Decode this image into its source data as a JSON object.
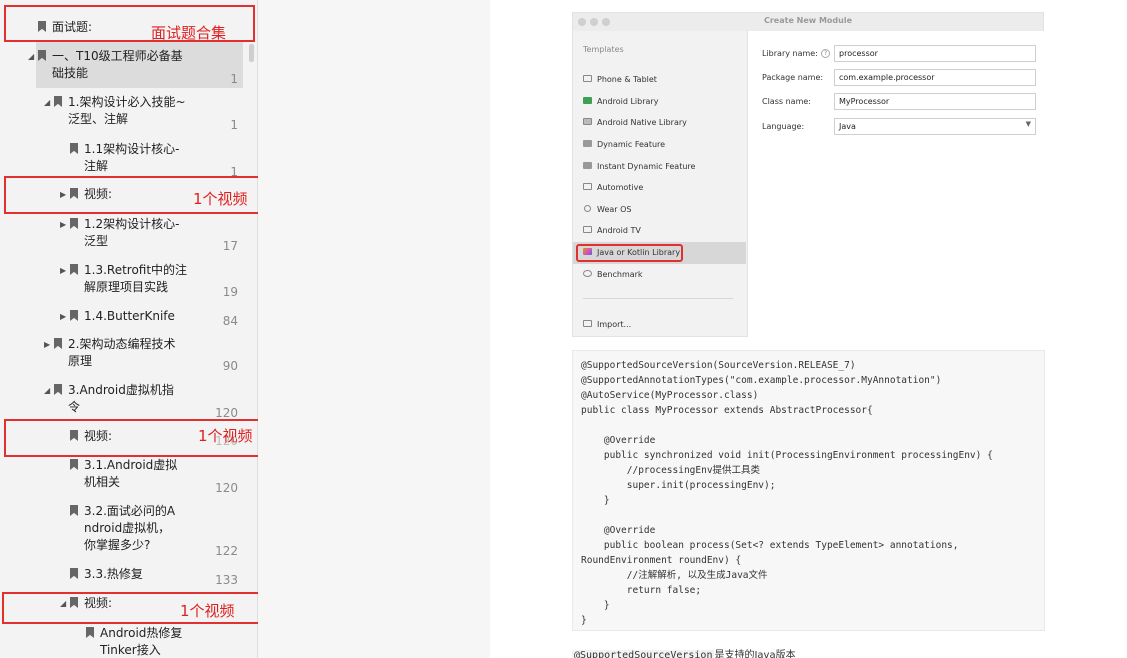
{
  "sidebar": {
    "items": [
      {
        "label": "面试题:",
        "page": ""
      },
      {
        "label": "一、T10级工程师必备基础技能",
        "page": "1"
      },
      {
        "label": "1.架构设计必入技能~泛型、注解",
        "page": "1"
      },
      {
        "label": "1.1架构设计核心-注解",
        "page": "1"
      },
      {
        "label": "视频:",
        "page": ""
      },
      {
        "label": "1.2架构设计核心-泛型",
        "page": "17"
      },
      {
        "label": "1.3.Retrofit中的注解原理项目实践",
        "page": "19"
      },
      {
        "label": "1.4.ButterKnife",
        "page": "84"
      },
      {
        "label": "2.架构动态编程技术原理",
        "page": "90"
      },
      {
        "label": "3.Android虚拟机指令",
        "page": "120"
      },
      {
        "label": "视频:",
        "page": "120"
      },
      {
        "label": "3.1.Android虚拟机相关",
        "page": "120"
      },
      {
        "label": "3.2.面试必问的Android虚拟机，你掌握多少?",
        "page": "122"
      },
      {
        "label": "3.3.热修复",
        "page": "133"
      },
      {
        "label": "视频:",
        "page": ""
      },
      {
        "label": "Android热修复Tinker接入",
        "page": ""
      }
    ],
    "annotations": [
      "面试题合集",
      "1个视频",
      "1个视频",
      "1个视频"
    ]
  },
  "dialog": {
    "title": "Create New Module",
    "templates_heading": "Templates",
    "templates": [
      "Phone & Tablet",
      "Android Library",
      "Android Native Library",
      "Dynamic Feature",
      "Instant Dynamic Feature",
      "Automotive",
      "Wear OS",
      "Android TV",
      "Java or Kotlin Library",
      "Benchmark"
    ],
    "import_label": "Import...",
    "fields": [
      {
        "label": "Library name:",
        "value": "processor"
      },
      {
        "label": "Package name:",
        "value": "com.example.processor"
      },
      {
        "label": "Class name:",
        "value": "MyProcessor"
      },
      {
        "label": "Language:",
        "value": "Java"
      }
    ]
  },
  "code": "@SupportedSourceVersion(SourceVersion.RELEASE_7)\n@SupportedAnnotationTypes(\"com.example.processor.MyAnnotation\")\n@AutoService(MyProcessor.class)\npublic class MyProcessor extends AbstractProcessor{\n\n    @Override\n    public synchronized void init(ProcessingEnvironment processingEnv) {\n        //processingEnv提供工具类\n        super.init(processingEnv);\n    }\n\n    @Override\n    public boolean process(Set<? extends TypeElement> annotations,\nRoundEnvironment roundEnv) {\n        //注解解析, 以及生成Java文件\n        return false;\n    }\n}",
  "bottom": {
    "code_term": "@SupportedSourceVersion",
    "text": "是支持的Java版本"
  }
}
